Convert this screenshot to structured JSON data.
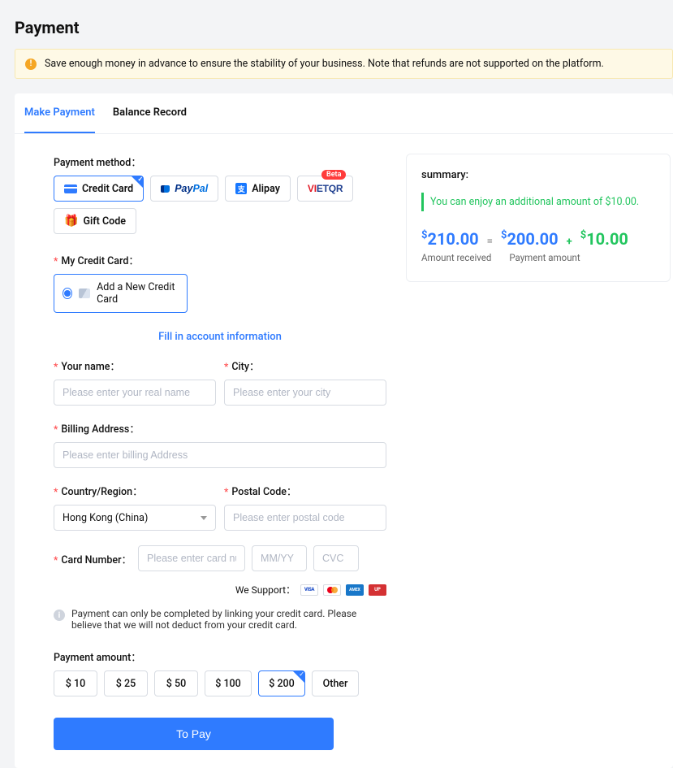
{
  "page": {
    "title": "Payment"
  },
  "alert": {
    "text": "Save enough money in advance to ensure the stability of your business. Note that refunds are not supported on the platform."
  },
  "tabs": {
    "make_payment": "Make Payment",
    "balance_record": "Balance Record"
  },
  "method": {
    "label": "Payment method：",
    "credit_card": "Credit Card",
    "paypal_pay": "Pay",
    "paypal_pal": "Pal",
    "alipay": "Alipay",
    "vietqr_beta": "Beta",
    "gift_code": "Gift Code"
  },
  "mycard": {
    "label": "My Credit Card：",
    "add_new": "Add a New Credit Card"
  },
  "fill_link": "Fill in account information",
  "form": {
    "name_label": "Your name：",
    "name_ph": "Please enter your real name",
    "city_label": "City：",
    "city_ph": "Please enter your city",
    "addr_label": "Billing Address：",
    "addr_ph": "Please enter billing Address",
    "country_label": "Country/Region：",
    "country_value": "Hong Kong (China)",
    "postal_label": "Postal Code：",
    "postal_ph": "Please enter postal code",
    "card_label": "Card Number：",
    "card_ph": "Please enter card nu...",
    "exp_ph": "MM/YY",
    "cvc_ph": "CVC"
  },
  "support": {
    "label": "We Support："
  },
  "note": {
    "text": "Payment can only be completed by linking your credit card. Please believe that we will not deduct from your credit card."
  },
  "amount": {
    "label": "Payment amount：",
    "opts": [
      "$ 10",
      "$ 25",
      "$ 50",
      "$ 100",
      "$ 200",
      "Other"
    ],
    "selected_index": 4
  },
  "pay_button": "To Pay",
  "summary": {
    "title": "summary:",
    "promo": "You can enjoy an additional amount of $10.00.",
    "received": "210.00",
    "payment": "200.00",
    "bonus": "10.00",
    "received_label": "Amount received",
    "payment_label": "Payment amount"
  }
}
